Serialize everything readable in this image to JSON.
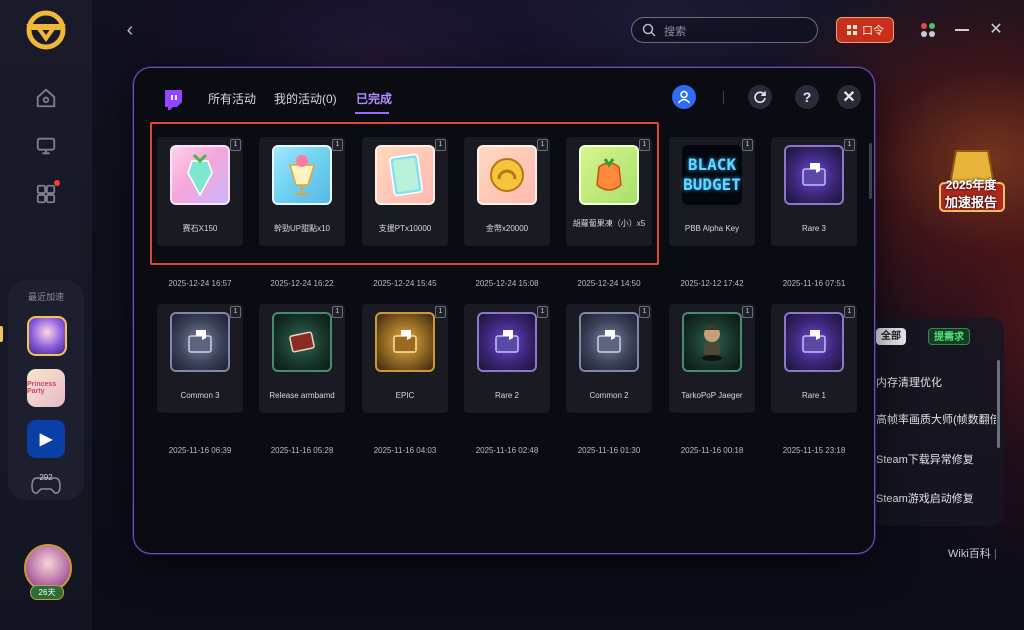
{
  "topbar": {
    "search_placeholder": "搜索",
    "kouling_label": "口令"
  },
  "sidebar": {
    "recent_label": "最近加速",
    "game2_text": "Princess Party",
    "controller_count": "292",
    "days_label": "26天"
  },
  "right_panel": {
    "report_year": "2025年度",
    "report_title": "加速报告",
    "chip_all": "全部",
    "chip_request": "提需求",
    "items": [
      "内存清理优化",
      "高帧率画质大师(帧数翻倍)",
      "Steam下载异常修复",
      "Steam游戏启动修复"
    ],
    "wiki": "Wiki百科"
  },
  "modal": {
    "tabs": [
      {
        "label": "所有活动"
      },
      {
        "label": "我的活动(0)"
      },
      {
        "label": "已完成"
      }
    ],
    "active_tab": "已完成",
    "rewards": [
      {
        "name": "赛石X150",
        "time": "2025-12-24 16:57",
        "qty": "1",
        "icon": "carrot-crystal-icon"
      },
      {
        "name": "幹勁UP甜點x10",
        "time": "2025-12-24 16:22",
        "qty": "1",
        "icon": "parfait-icon"
      },
      {
        "name": "支援PTx10000",
        "time": "2025-12-24 15:45",
        "qty": "1",
        "icon": "support-card-icon"
      },
      {
        "name": "金幣x20000",
        "time": "2025-12-24 15:08",
        "qty": "1",
        "icon": "gold-horseshoe-icon"
      },
      {
        "name": "胡蘿蔔果凍（小）x5",
        "time": "2025-12-24 14:50",
        "qty": "1",
        "icon": "carrot-jelly-icon"
      },
      {
        "name": "PBB Alpha Key",
        "time": "2025-12-12 17:42",
        "qty": "1",
        "icon": "black-budget-icon"
      },
      {
        "name": "Rare 3",
        "time": "2025-11-16 07:51",
        "qty": "1",
        "icon": "purple-chest-icon"
      },
      {
        "name": "Common 3",
        "time": "2025-11-16 06:39",
        "qty": "1",
        "icon": "gray-chest-icon"
      },
      {
        "name": "Release armbamd",
        "time": "2025-11-16 05:28",
        "qty": "1",
        "icon": "armband-icon"
      },
      {
        "name": "EPIC",
        "time": "2025-11-16 04:03",
        "qty": "1",
        "icon": "gold-chest-icon"
      },
      {
        "name": "Rare 2",
        "time": "2025-11-16 02:48",
        "qty": "1",
        "icon": "purple-chest-icon"
      },
      {
        "name": "Common 2",
        "time": "2025-11-16 01:30",
        "qty": "1",
        "icon": "gray-chest-icon"
      },
      {
        "name": "TarkoPoP Jaeger",
        "time": "2025-11-16 00:18",
        "qty": "1",
        "icon": "jaeger-figure-icon"
      },
      {
        "name": "Rare 1",
        "time": "2025-11-15 23:18",
        "qty": "1",
        "icon": "purple-chest-icon"
      }
    ],
    "black_budget_lines": [
      "BLACK",
      "BUDGET"
    ]
  },
  "colors": {
    "accent_purple": "#9b6bff",
    "highlight_red": "#e0463d",
    "kouling_red": "#c8301e",
    "user_blue": "#2f6cf4"
  }
}
